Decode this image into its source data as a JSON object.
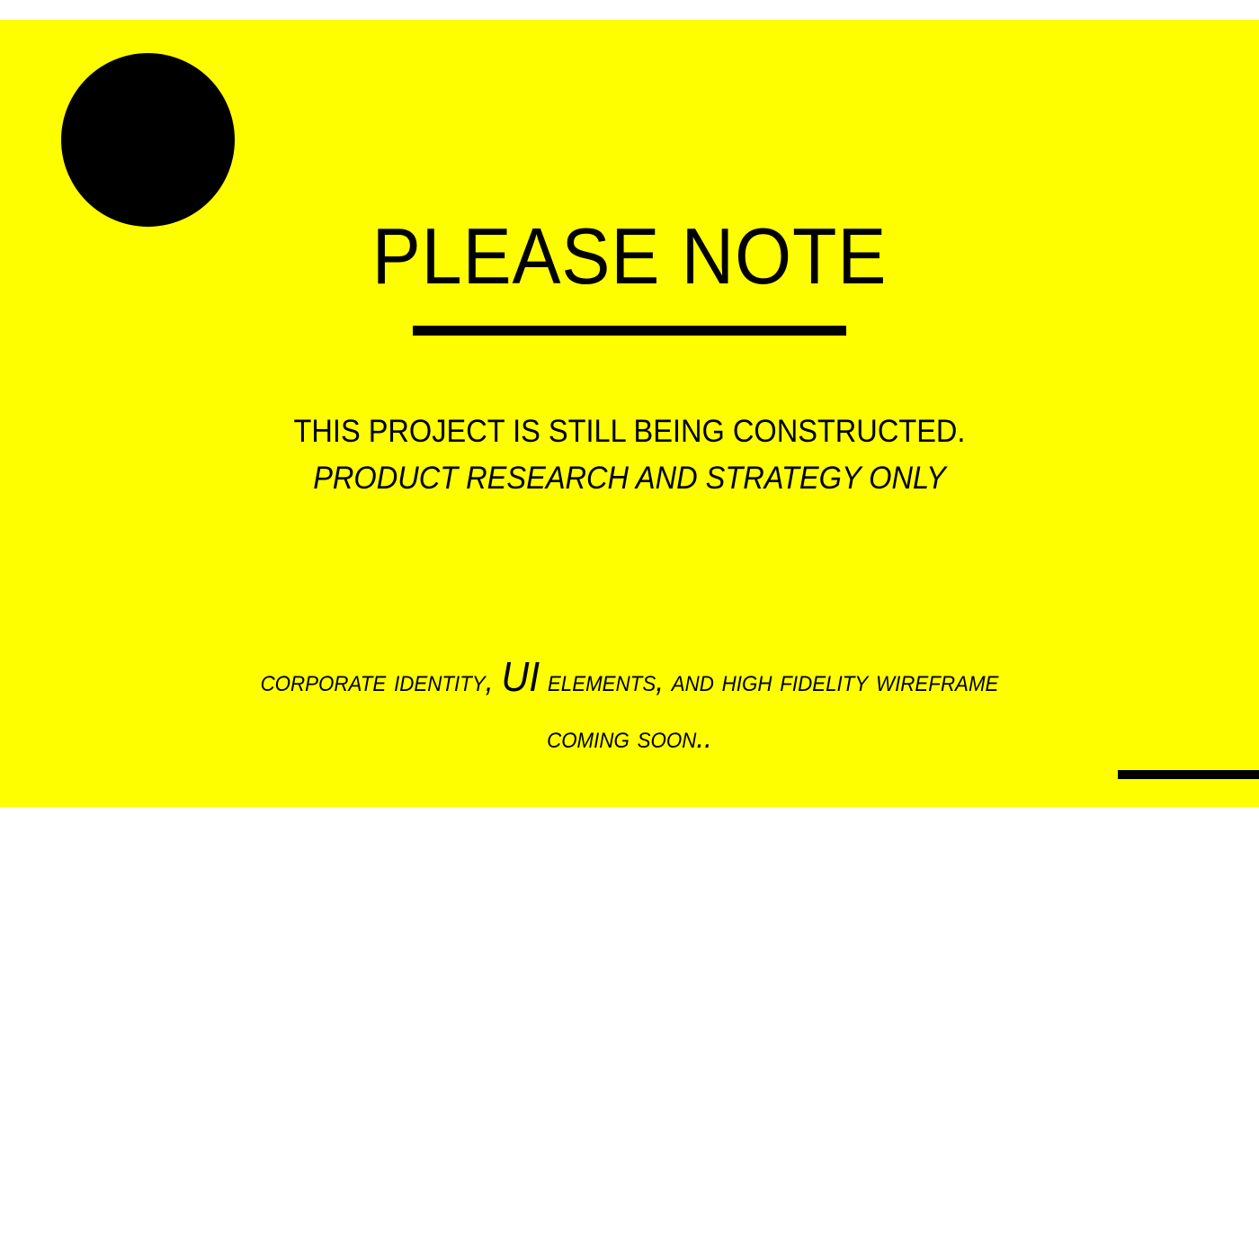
{
  "colors": {
    "banner_background": "#fefe00",
    "ink": "#000000",
    "page_background": "#ffffff"
  },
  "notice": {
    "title": "PLEASE NOTE",
    "status": "THIS PROJECT IS STILL BEING CONSTRUCTED.",
    "scope": "PRODUCT RESEARCH AND STRATEGY ONLY",
    "coming": {
      "part_1": "corporate identity, ",
      "part_2": "UI",
      "part_3": " elements, and high fidelity wireframe",
      "line_2": "coming soon.."
    }
  }
}
